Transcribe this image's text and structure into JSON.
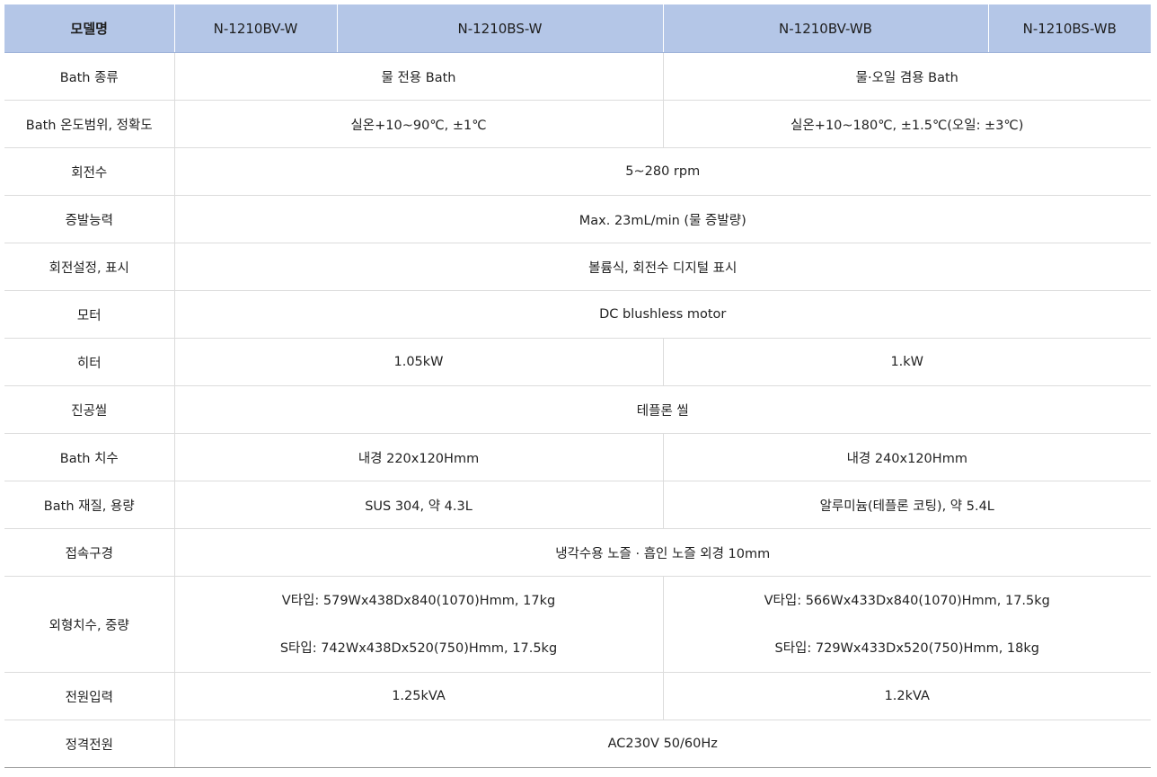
{
  "header": {
    "label": "모델명",
    "models": [
      "N-1210BV-W",
      "N-1210BS-W",
      "N-1210BV-WB",
      "N-1210BS-WB"
    ]
  },
  "rows": {
    "bath_type": {
      "label": "Bath 종류",
      "w": "물 전용 Bath",
      "wb": "물·오일 겸용 Bath"
    },
    "bath_temp": {
      "label": "Bath 온도범위, 정확도",
      "w": "실온+10~90℃, ±1℃",
      "wb": "실온+10~180℃, ±1.5℃(오일: ±3℃)"
    },
    "rotation": {
      "label": "회전수",
      "all": "5~280 rpm"
    },
    "evaporation": {
      "label": "증발능력",
      "all": "Max. 23mL/min (물 증발량)"
    },
    "rotation_display": {
      "label": "회전설정, 표시",
      "all": "볼륨식, 회전수 디지털 표시"
    },
    "motor": {
      "label": "모터",
      "all": "DC blushless motor"
    },
    "heater": {
      "label": "히터",
      "w": "1.05kW",
      "wb": "1.kW"
    },
    "vacuum_seal": {
      "label": "진공씰",
      "all": "테플론 씰"
    },
    "bath_size": {
      "label": "Bath 치수",
      "w": "내경 220x120Hmm",
      "wb": "내경 240x120Hmm"
    },
    "bath_material": {
      "label": "Bath 재질, 용량",
      "w": "SUS 304, 약 4.3L",
      "wb": "알루미늄(테플론 코팅), 약 5.4L"
    },
    "connection": {
      "label": "접속구경",
      "all": "냉각수용 노즐 · 흡인 노즐 외경 10mm"
    },
    "dimensions": {
      "label": "외형치수, 중량",
      "w_v": "V타입: 579Wx438Dx840(1070)Hmm, 17kg",
      "w_s": "S타입: 742Wx438Dx520(750)Hmm, 17.5kg",
      "wb_v": "V타입: 566Wx433Dx840(1070)Hmm, 17.5kg",
      "wb_s": "S타입: 729Wx433Dx520(750)Hmm, 18kg"
    },
    "power_input": {
      "label": "전원입력",
      "w": "1.25kVA",
      "wb": "1.2kVA"
    },
    "rated_power": {
      "label": "정격전원",
      "all": "AC230V 50/60Hz"
    }
  },
  "colors": {
    "header_bg": "#b4c6e7",
    "grid_line": "#dcdcdc",
    "text": "#222222"
  }
}
